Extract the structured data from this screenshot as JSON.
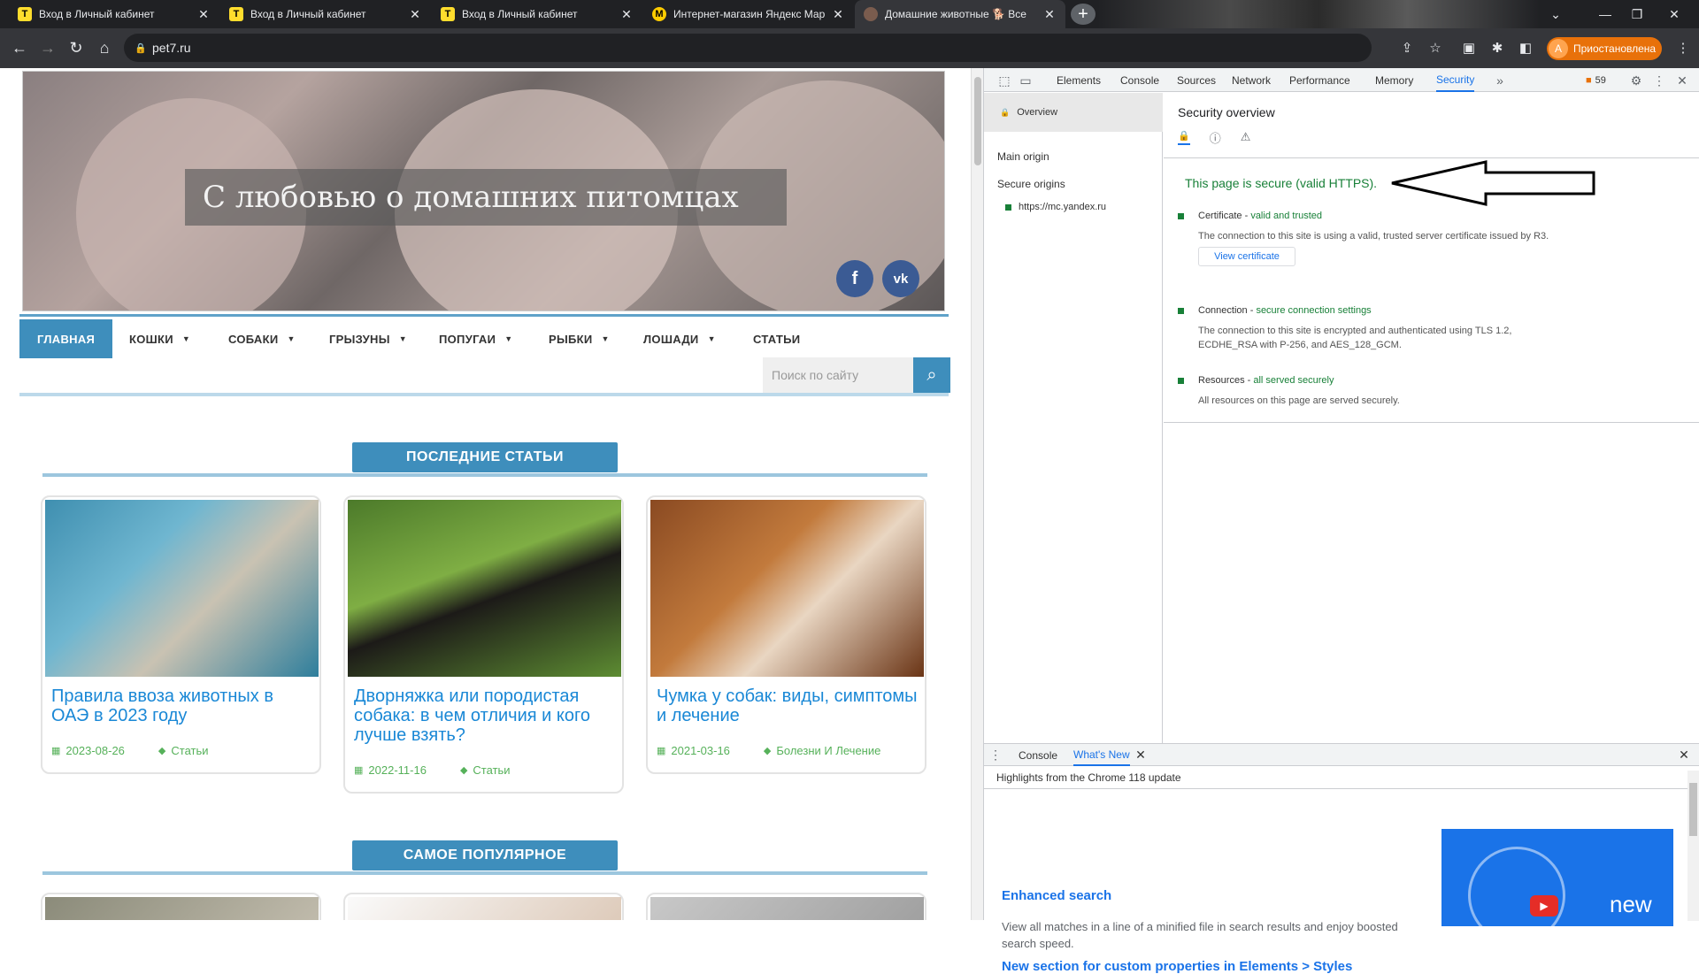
{
  "browser": {
    "tabs": [
      {
        "title": "Вход в Личный кабинет",
        "favicon": "T"
      },
      {
        "title": "Вход в Личный кабинет",
        "favicon": "T"
      },
      {
        "title": "Вход в Личный кабинет",
        "favicon": "T"
      },
      {
        "title": "Интернет-магазин Яндекс Мар",
        "favicon": "M"
      },
      {
        "title": "Домашние животные 🐕 Все",
        "favicon": ""
      }
    ],
    "url": "pet7.ru",
    "profile_initial": "A",
    "profile_label": "Приостановлена"
  },
  "site": {
    "hero_title": "С любовью о домашних питомцах",
    "social": [
      "f",
      "vk"
    ],
    "menu": [
      {
        "label": "ГЛАВНАЯ"
      },
      {
        "label": "КОШКИ"
      },
      {
        "label": "СОБАКИ"
      },
      {
        "label": "ГРЫЗУНЫ"
      },
      {
        "label": "ПОПУГАИ"
      },
      {
        "label": "РЫБКИ"
      },
      {
        "label": "ЛОШАДИ"
      },
      {
        "label": "СТАТЬИ"
      }
    ],
    "search_placeholder": "Поиск по сайту",
    "section_latest": "ПОСЛЕДНИЕ СТАТЬИ",
    "section_popular": "САМОЕ ПОПУЛЯРНОЕ",
    "articles": [
      {
        "title": "Правила ввоза животных в ОАЭ в 2023 году",
        "date": "2023-08-26",
        "category": "Статьи"
      },
      {
        "title": "Дворняжка или породистая собака: в чем отличия и кого лучше взять?",
        "date": "2022-11-16",
        "category": "Статьи"
      },
      {
        "title": "Чумка у собак: виды, симптомы и лечение",
        "date": "2021-03-16",
        "category": "Болезни И Лечение"
      }
    ]
  },
  "devtools": {
    "tabs": [
      "Elements",
      "Console",
      "Sources",
      "Network",
      "Performance",
      "Memory",
      "Security"
    ],
    "active_tab": "Security",
    "issues_count": "59",
    "sidebar": {
      "overview": "Overview",
      "main_origin": "Main origin",
      "secure_origins": "Secure origins",
      "origin": "https://mc.yandex.ru"
    },
    "overview_title": "Security overview",
    "secure_msg": "This page is secure (valid HTTPS).",
    "certificate": {
      "label": "Certificate",
      "status": "valid and trusted",
      "desc": "The connection to this site is using a valid, trusted server certificate issued by R3.",
      "button": "View certificate"
    },
    "connection": {
      "label": "Connection",
      "status": "secure connection settings",
      "desc": "The connection to this site is encrypted and authenticated using TLS 1.2, ECDHE_RSA with P-256, and AES_128_GCM."
    },
    "resources": {
      "label": "Resources",
      "status": "all served securely",
      "desc": "All resources on this page are served securely."
    },
    "drawer": {
      "tabs": [
        "Console",
        "What's New"
      ],
      "highlight": "Highlights from the Chrome 118 update",
      "item1_title": "Enhanced search",
      "item1_desc": "View all matches in a line of a minified file in search results and enjoy boosted search speed.",
      "item2_title": "New section for custom properties in Elements > Styles",
      "banner_text": "new"
    }
  },
  "colors": {
    "accent": "#3e8ebc",
    "link": "#1a88d6",
    "meta_green": "#56b15a",
    "secure_green": "#188038",
    "devtools_blue": "#1a73e8"
  }
}
